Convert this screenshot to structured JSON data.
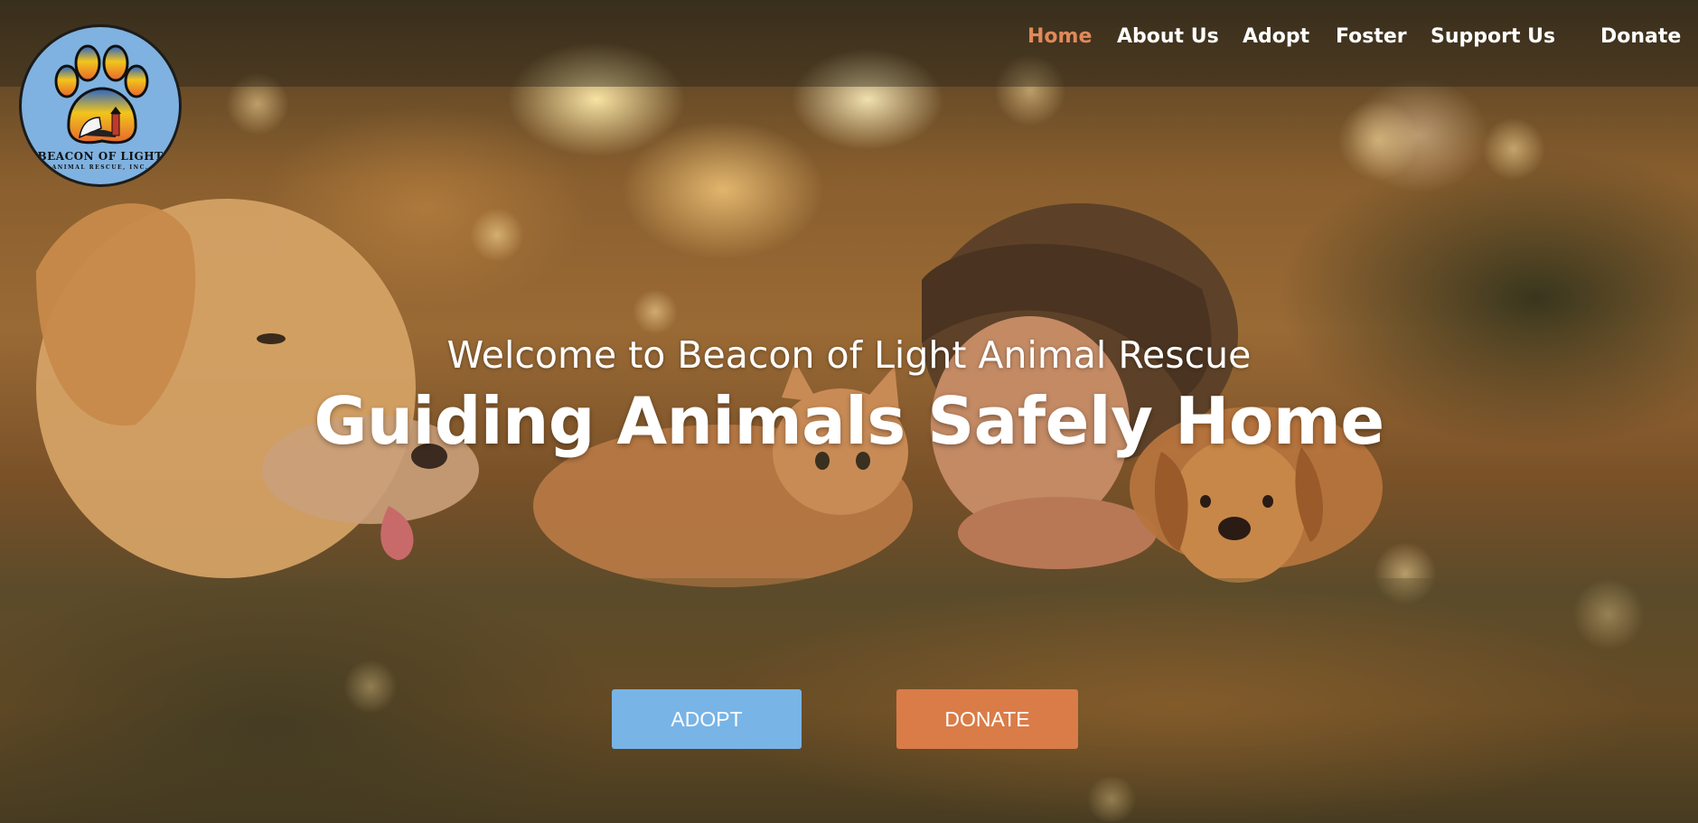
{
  "header": {
    "logo": {
      "line1": "BEACON OF LIGHT",
      "line2": "ANIMAL RESCUE, INC."
    },
    "nav": [
      {
        "label": "Home",
        "active": true
      },
      {
        "label": "About Us",
        "active": false
      },
      {
        "label": "Adopt",
        "active": false
      },
      {
        "label": "Foster",
        "active": false
      },
      {
        "label": "Support Us",
        "active": false
      },
      {
        "label": "Donate",
        "active": false
      }
    ]
  },
  "hero": {
    "welcome": "Welcome to Beacon of Light Animal Rescue",
    "headline": "Guiding Animals Safely Home",
    "buttons": {
      "adopt": "ADOPT",
      "donate": "DONATE"
    }
  },
  "colors": {
    "nav_active": "#e0895a",
    "adopt_button": "#78b4e6",
    "donate_button": "#d97c48",
    "logo_background": "#7fb2e0"
  },
  "icons": [
    "paw-print-logo-icon",
    "lighthouse-icon"
  ]
}
